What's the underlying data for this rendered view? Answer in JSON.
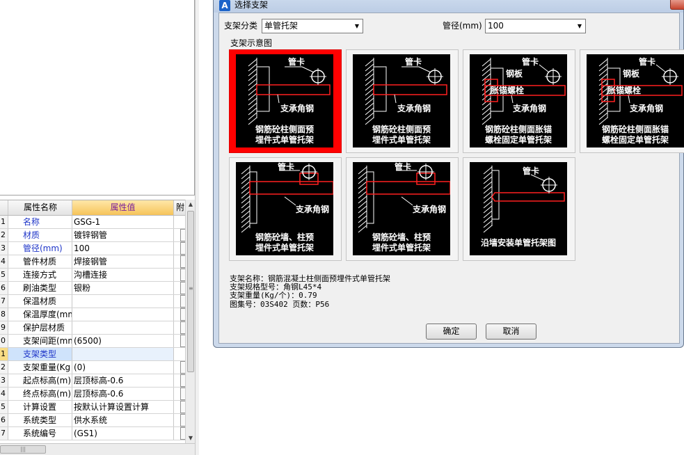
{
  "grid": {
    "headers": {
      "name": "属性名称",
      "value": "属性值",
      "attach": "附"
    },
    "rows": [
      {
        "num": "1",
        "name": "名称",
        "value": "GSG-1",
        "blue": true,
        "box": false
      },
      {
        "num": "2",
        "name": "材质",
        "value": "镀锌钢管",
        "blue": true,
        "box": true
      },
      {
        "num": "3",
        "name": "管径(mm)",
        "value": "100",
        "blue": true,
        "box": true
      },
      {
        "num": "4",
        "name": "管件材质",
        "value": "焊接钢管",
        "blue": false,
        "box": true
      },
      {
        "num": "5",
        "name": "连接方式",
        "value": "沟槽连接",
        "blue": false,
        "box": true
      },
      {
        "num": "6",
        "name": "刷油类型",
        "value": "银粉",
        "blue": false,
        "box": true
      },
      {
        "num": "7",
        "name": "保温材质",
        "value": "",
        "blue": false,
        "box": true
      },
      {
        "num": "8",
        "name": "保温厚度(mm",
        "value": "",
        "blue": false,
        "box": true
      },
      {
        "num": "9",
        "name": "保护层材质",
        "value": "",
        "blue": false,
        "box": true
      },
      {
        "num": "0",
        "name": "支架间距(mm",
        "value": "(6500)",
        "blue": false,
        "box": true
      },
      {
        "num": "1",
        "name": "支架类型",
        "value": "",
        "blue": true,
        "box": false,
        "selected": true
      },
      {
        "num": "2",
        "name": "支架重量(Kg",
        "value": "(0)",
        "blue": false,
        "box": true
      },
      {
        "num": "3",
        "name": "起点标高(m)",
        "value": "层顶标高-0.6",
        "blue": false,
        "box": true
      },
      {
        "num": "4",
        "name": "终点标高(m)",
        "value": "层顶标高-0.6",
        "blue": false,
        "box": true
      },
      {
        "num": "5",
        "name": "计算设置",
        "value": "按默认计算设置计算",
        "blue": false,
        "box": true
      },
      {
        "num": "6",
        "name": "系统类型",
        "value": "供水系统",
        "blue": false,
        "box": true
      },
      {
        "num": "7",
        "name": "系统编号",
        "value": "(GS1)",
        "blue": false,
        "box": true
      }
    ]
  },
  "dialog": {
    "icon_letter": "A",
    "title": "选择支架",
    "category_label": "支架分类",
    "category_value": "单管托架",
    "diameter_label": "管径(mm)",
    "diameter_value": "100",
    "group_label": "支架示意图",
    "tiles": [
      {
        "style": "wall-clamp",
        "selected": true,
        "labels": [
          "管卡",
          "支承角钢"
        ],
        "title1": "钢筋砼柱侧面预",
        "title2": "埋件式单管托架"
      },
      {
        "style": "wall-clamp",
        "selected": false,
        "labels": [
          "管卡",
          "支承角钢"
        ],
        "title1": "钢筋砼柱侧面预",
        "title2": "埋件式单管托架"
      },
      {
        "style": "wall-bolt",
        "selected": false,
        "labels": [
          "管卡",
          "钢板",
          "胀锚螺栓",
          "支承角钢"
        ],
        "title1": "钢筋砼柱侧面胀锚",
        "title2": "螺栓固定单管托架"
      },
      {
        "style": "wall-bolt",
        "selected": false,
        "labels": [
          "管卡",
          "钢板",
          "胀锚螺栓",
          "支承角钢"
        ],
        "title1": "钢筋砼柱侧面胀锚",
        "title2": "螺栓固定单管托架"
      },
      {
        "style": "wall-long",
        "selected": false,
        "labels": [
          "管卡",
          "支承角钢"
        ],
        "title1": "钢筋砼墙、柱预",
        "title2": "埋件式单管托架"
      },
      {
        "style": "wall-long",
        "selected": false,
        "labels": [
          "管卡",
          "支承角钢"
        ],
        "title1": "钢筋砼墙、柱预",
        "title2": "埋件式单管托架"
      },
      {
        "style": "wall-along",
        "selected": false,
        "labels": [
          "管卡"
        ],
        "title1": "",
        "title2": "沿墙安装单管托架图"
      }
    ],
    "info": [
      "支架名称：钢筋混凝土柱侧面预埋件式单管托架",
      "支架规格型号：角钢L45*4",
      "支架重量(Kg/个)：0.79",
      "图集号：03S402  页数：P56"
    ],
    "ok_label": "确定",
    "cancel_label": "取消"
  },
  "colors": {
    "selected_tile": "#ff0000",
    "drawing_red": "#ff2020",
    "header_value_text": "#7a1f9a",
    "link_blue": "#1e35c8"
  }
}
